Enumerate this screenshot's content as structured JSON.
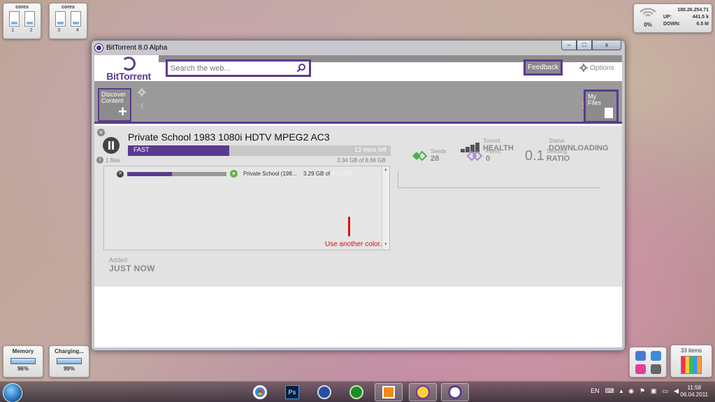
{
  "gadgets": {
    "cores_left": {
      "title": "cores",
      "nums": [
        "1",
        "2"
      ]
    },
    "cores_right": {
      "title": "cores",
      "nums": [
        "3",
        "4"
      ]
    },
    "network": {
      "ip": "188.26.254.71",
      "signal_pct": "0%",
      "up_label": "UP:",
      "up_value": "441.5 k",
      "down_label": "DOWN:",
      "down_value": "6.5 M"
    },
    "memory": {
      "title": "Memory",
      "value": "96%"
    },
    "battery": {
      "title": "Charging...",
      "value": "99%"
    },
    "recycle": {
      "title": "33 items"
    }
  },
  "window": {
    "title": "BitTorrent 8.0 Alpha",
    "controls": {
      "minimize": "–",
      "maximize": "□",
      "close": "x"
    }
  },
  "header": {
    "logo_text": "BitTorrent",
    "search_placeholder": "Search the web...",
    "feedback_label": "Feedback",
    "options_label": "Options"
  },
  "nav": {
    "discover_label_1": "Discover",
    "discover_label_2": "Content",
    "discover_plus": "+",
    "my_files_label_1": "My",
    "my_files_label_2": "Files",
    "arrow_left": "‹",
    "arrow_right": "›"
  },
  "torrent": {
    "title": "Private School 1983 1080i HDTV MPEG2 AC3",
    "speed_label": "FAST",
    "eta": "13 mins left",
    "progress": 0.385,
    "size_text": "3.34 GB of 8.66 GB",
    "files_count": "1 files",
    "added_label": "Added",
    "added_value": "JUST NOW",
    "health_label": "Torrent",
    "health_value": "HEALTH",
    "status_label": "Status",
    "status_value": "DOWNLOADING",
    "seeds_label": "Seeds",
    "seeds_value": "28",
    "peers_label": "Peers",
    "peers_value": "0",
    "ratio_big": "0.1",
    "ratio_label": "Seeding",
    "ratio_value": "RATIO"
  },
  "file": {
    "name": "Private School (198...",
    "downloaded": "3.29 GB of",
    "total": "8.66 GB",
    "progress": 0.45
  },
  "annotation": {
    "text": "Use another color.",
    "color": "#d01010"
  },
  "colors": {
    "accent": "#5a3a8f"
  },
  "taskbar": {
    "apps": [
      "chrome-icon",
      "photoshop-icon",
      "winamp-icon",
      "utorrent-icon",
      "media-player-icon",
      "yahoo-messenger-icon",
      "bittorrent-icon"
    ],
    "photoshop_label": "Ps",
    "tray_lang": "EN",
    "time": "11:58",
    "date": "06.04.2011"
  }
}
